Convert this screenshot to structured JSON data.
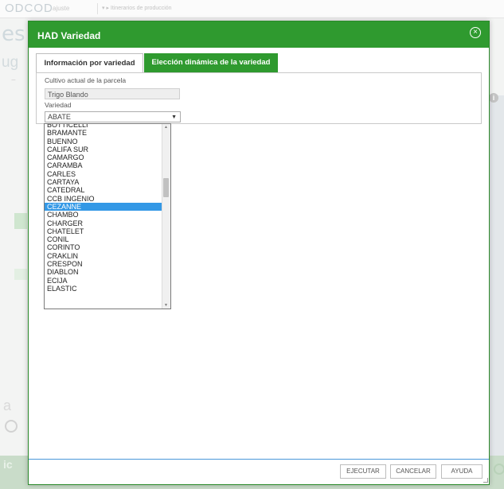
{
  "background": {
    "logo": "ODCOD",
    "top_nav": "ajuste",
    "crumb": "▾  ▸  Itinerarios de producción",
    "big_letter": "es",
    "side_letter": "ug",
    "bottom_letter": "a",
    "footer_letter": "ic"
  },
  "dialog": {
    "title": "HAD Variedad",
    "close_icon": "close-circle-icon",
    "tabs": [
      {
        "label": "Información por variedad",
        "active": true
      },
      {
        "label": "Elección dinámica de la variedad",
        "active": false
      }
    ],
    "crop_label": "Cultivo actual de la parcela",
    "crop_value": "Trigo Blando",
    "variety_label": "Variedad",
    "variety_selected": "ABATE",
    "variety_options": [
      "BOTTICELLI",
      "BRAMANTE",
      "BUENNO",
      "CALIFA SUR",
      "CAMARGO",
      "CARAMBA",
      "CARLES",
      "CARTAYA",
      "CATEDRAL",
      "CCB INGENIO",
      "CEZANNE",
      "CHAMBO",
      "CHARGER",
      "CHATELET",
      "CONIL",
      "CORINTO",
      "CRAKLIN",
      "CRESPON",
      "DIABLON",
      "ECIJA",
      "ELASTIC"
    ],
    "highlighted_option": "CEZANNE",
    "buttons": {
      "execute": "EJECUTAR",
      "cancel": "CANCELAR",
      "help": "AYUDA"
    }
  },
  "colors": {
    "header_green": "#2f9a2f",
    "highlight_blue": "#3398e6",
    "footer_line_blue": "#4a98d9"
  }
}
